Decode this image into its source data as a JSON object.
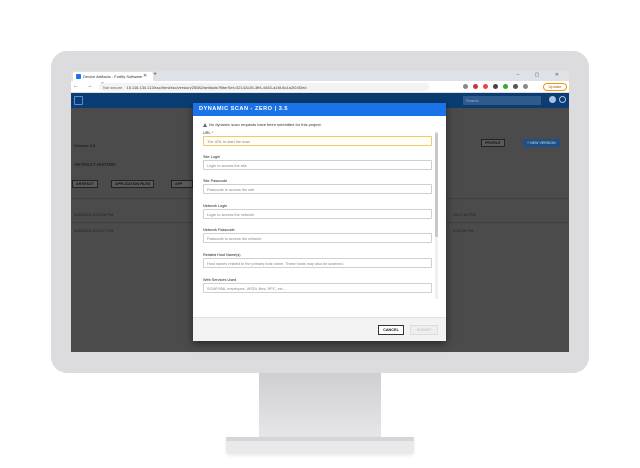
{
  "browser": {
    "tab_title": "Device Artifacts - Fortify Software",
    "new_tab": "+",
    "window_controls": "– ▢ ✕",
    "nav_icons": "← → C",
    "not_secure": "Not secure",
    "url": "15.116.134.113/ssc/html/ssc/version/25082/artifacts?filterSet=32142c26-3ff4-4463-a16f-8c1a2f24f2ed",
    "update_label": "Update"
  },
  "app": {
    "search_placeholder": "Search",
    "version_label": "Version 3.5",
    "section_title": "ARTIFACT HISTORY",
    "buttons": {
      "artifact": "ARTIFACT",
      "application_files": "APPLICATION FILES",
      "third": "APP",
      "profile": "PROFILE",
      "new_version": "+ NEW VERSION"
    },
    "rows": [
      {
        "date": "3/26/2020 3:43:06 PM",
        "end": "…15:27:52 PM"
      },
      {
        "date": "3/26/2020 3:23:47 PM",
        "end": "…3:43:10 PM"
      }
    ]
  },
  "modal": {
    "title": "DYNAMIC SCAN - ZERO | 3.5",
    "alert": "No dynamic scan requests have been submitted for this project.",
    "fields": [
      {
        "label": "URL",
        "required": "*",
        "placeholder": "The URL to start the scan"
      },
      {
        "label": "Site Login",
        "required": "",
        "placeholder": "Login to access the site"
      },
      {
        "label": "Site Passcode",
        "required": "",
        "placeholder": "Passcode to access the site"
      },
      {
        "label": "Network Login",
        "required": "",
        "placeholder": "Login to access the network"
      },
      {
        "label": "Network Passcode",
        "required": "",
        "placeholder": "Passcode to access the network"
      },
      {
        "label": "Related Host Name(s)",
        "required": "",
        "placeholder": "Host names related to the primary host name.  These hosts may also be scanned."
      },
      {
        "label": "Web Services Used",
        "required": "",
        "placeholder": "SOAP/XML envelopes, WSDL files, RPC, etc..."
      }
    ],
    "cancel_label": "CANCEL",
    "submit_label": "SUBMIT"
  },
  "colors": {
    "modal_header": "#1a73e8",
    "app_topbar": "#0b3d74",
    "required": "#d93025"
  }
}
